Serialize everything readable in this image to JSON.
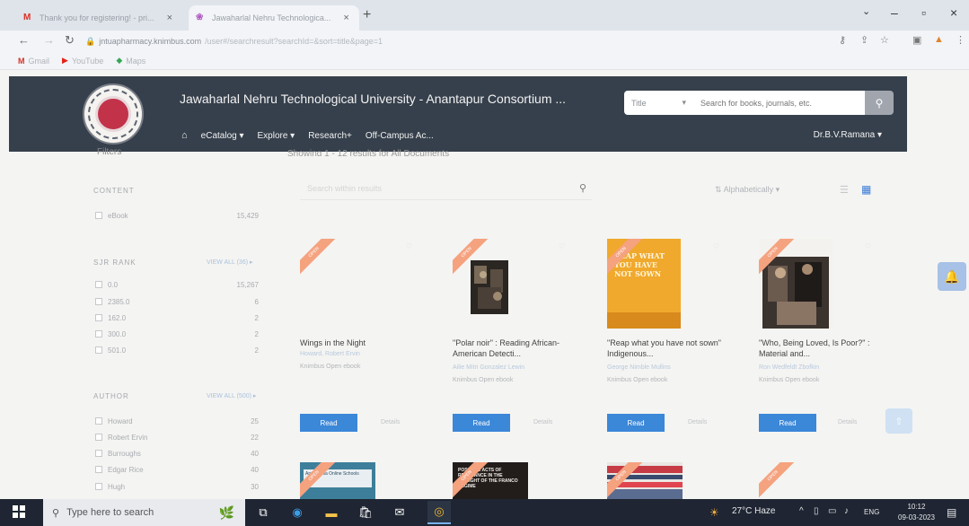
{
  "browser": {
    "tabs": [
      {
        "label": "Thank you for registering! - pri..."
      },
      {
        "label": "Jawaharlal Nehru Technologica..."
      }
    ],
    "url_host": "jntuapharmacy.knimbus.com",
    "url_rest": "/user#/searchresult?searchId=&sort=title&page=1",
    "bookmarks": [
      {
        "label": "Gmail"
      },
      {
        "label": "YouTube"
      },
      {
        "label": "Maps"
      }
    ]
  },
  "site": {
    "title": "Jawaharlal Nehru Technological University - Anantapur Consortium ...",
    "search_select": "Title",
    "search_placeholder": "Search for books, journals, etc.",
    "menu": [
      {
        "label": "eCatalog ▾"
      },
      {
        "label": "Explore ▾"
      },
      {
        "label": "Research+"
      },
      {
        "label": "Off-Campus Ac..."
      }
    ],
    "user": "Dr.B.V.Ramana ▾",
    "logo_text": "JNTUA"
  },
  "content": {
    "filters_title": "Filters",
    "results_text": "Showing 1 - 12 results for All Documents",
    "content_head": "CONTENT",
    "content_rows": [
      {
        "label": "eBook",
        "count": "15,429"
      }
    ],
    "sirrank_head": "SJR RANK",
    "sirrank_more": "VIEW ALL (36) ▸",
    "sirrank_rows": [
      {
        "label": "0.0",
        "count": "15,267"
      },
      {
        "label": "2385.0",
        "count": "6"
      },
      {
        "label": "162.0",
        "count": "2"
      },
      {
        "label": "300.0",
        "count": "2"
      },
      {
        "label": "501.0",
        "count": "2"
      }
    ],
    "author_head": "AUTHOR",
    "author_more": "VIEW ALL (500) ▸",
    "author_rows": [
      {
        "label": "Howard",
        "count": "25"
      },
      {
        "label": "Robert Ervin",
        "count": "22"
      },
      {
        "label": "Burroughs",
        "count": "40"
      },
      {
        "label": "Edgar Rice",
        "count": "40"
      },
      {
        "label": "Hugh",
        "count": "30"
      }
    ],
    "search_placeholder": "Search within results",
    "sort": "Alphabetically ▾",
    "cards": [
      {
        "title": "Wings in the Night",
        "author": "Howard, Robert Ervin",
        "publisher": "Knimbus Open ebook",
        "ribbon": "OPEN",
        "read": "Read",
        "details": "Details"
      },
      {
        "title": "\"Polar noir\" : Reading African-American Detecti...",
        "author": "Ailie Mitri Gonzalez Lewin",
        "publisher": "Knimbus Open ebook",
        "ribbon": "OPEN",
        "read": "Read",
        "details": "Details"
      },
      {
        "title": "\"Reap what you have not sown\" Indigenous...",
        "author": "George Nimble Mullins",
        "publisher": "Knimbus Open ebook",
        "ribbon": "OPEN",
        "read": "Read",
        "details": "Details",
        "cover_text": "REAP WHAT YOU HAVE NOT SOWN"
      },
      {
        "title": "\"Who, Being Loved, Is Poor?\" : Material and...",
        "author": "Ron Wedfeldt Zbofkin",
        "publisher": "Knimbus Open ebook",
        "ribbon": "OPEN",
        "read": "Read",
        "details": "Details"
      }
    ],
    "row2_covers": [
      {
        "text": "Appalachia Online Schools"
      },
      {
        "text": "POSSIBLE ACTS OF RESISTANCE IN THE TWILIGHT OF THE FRANCO REGIME"
      }
    ]
  },
  "taskbar": {
    "search_placeholder": "Type here to search",
    "weather": "27°C Haze",
    "lang": "ENG",
    "time": "10:12",
    "date": "09-03-2023"
  },
  "colors": {
    "header": "#36404c",
    "read_button": "#3b87d8",
    "ribbon": "#f5a27f"
  }
}
